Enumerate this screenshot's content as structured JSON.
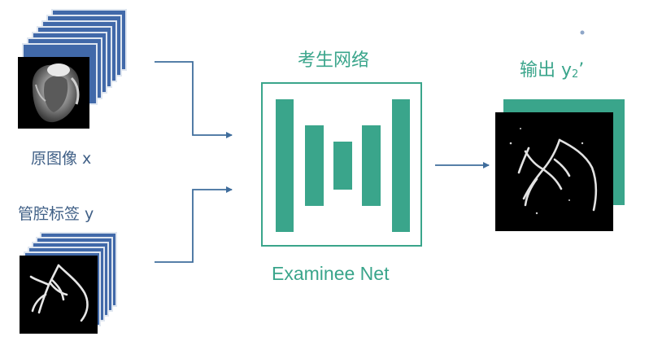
{
  "labels": {
    "source_images": "原图像 x",
    "vessel_labels": "管腔标签 y",
    "network_title": "考生网络",
    "network_name": "Examinee Net",
    "output_prefix": "输出 y",
    "output_subscript": "2",
    "output_suffix": "’"
  },
  "colors": {
    "stack_blue": "#4169a9",
    "stack_edge": "#dfe6f0",
    "teal": "#3aa58b",
    "arrow": "#3f6d9c",
    "label_blue": "#3f5f86",
    "image_bg": "#000000"
  },
  "icons": {
    "heart_ct_image": "cardiac-ct-scan",
    "vessel_mask_image": "coronary-vessel-mask",
    "output_mask_image": "predicted-vessel-mask"
  }
}
